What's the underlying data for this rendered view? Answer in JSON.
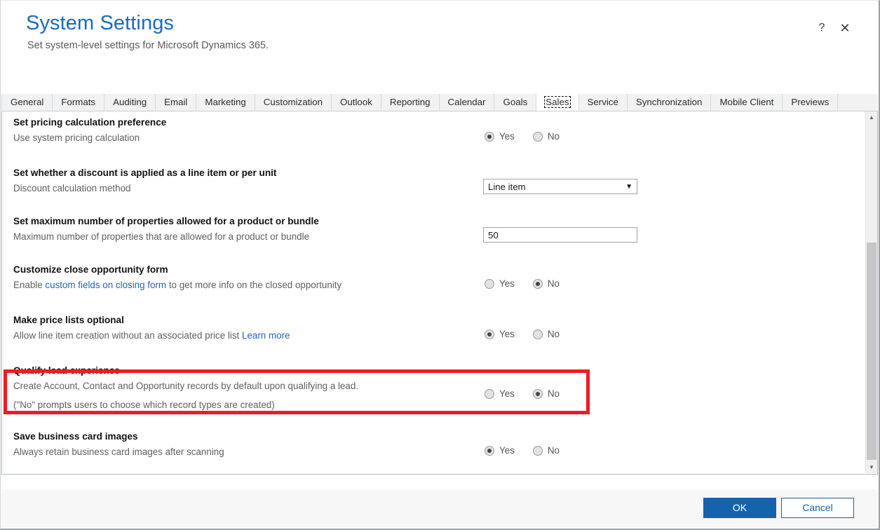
{
  "window": {
    "title": "System Settings",
    "subtitle": "Set system-level settings for Microsoft Dynamics 365.",
    "help_icon": "question-mark-icon",
    "close_icon": "close-icon",
    "accent_color": "#1a6bbd",
    "highlight_color": "#ed1c24"
  },
  "tabs": [
    {
      "label": "General",
      "active": false
    },
    {
      "label": "Formats",
      "active": false
    },
    {
      "label": "Auditing",
      "active": false
    },
    {
      "label": "Email",
      "active": false
    },
    {
      "label": "Marketing",
      "active": false
    },
    {
      "label": "Customization",
      "active": false
    },
    {
      "label": "Outlook",
      "active": false
    },
    {
      "label": "Reporting",
      "active": false
    },
    {
      "label": "Calendar",
      "active": false
    },
    {
      "label": "Goals",
      "active": false
    },
    {
      "label": "Sales",
      "active": true
    },
    {
      "label": "Service",
      "active": false
    },
    {
      "label": "Synchronization",
      "active": false
    },
    {
      "label": "Mobile Client",
      "active": false
    },
    {
      "label": "Previews",
      "active": false
    }
  ],
  "settings": [
    {
      "title": "Set pricing calculation preference",
      "desc": "Use system pricing calculation",
      "control": "radio",
      "yes_label": "Yes",
      "no_label": "No",
      "selected": "Yes"
    },
    {
      "title": "Set whether a discount is applied as a line item or per unit",
      "desc": "Discount calculation method",
      "control": "select",
      "value": "Line item",
      "arrow": "▼"
    },
    {
      "title": "Set maximum number of properties allowed for a product or bundle",
      "desc": "Maximum number of properties that are allowed for a product or bundle",
      "control": "text",
      "value": "50"
    },
    {
      "title": "Customize close opportunity form",
      "desc_pre": "Enable ",
      "desc_link": "custom fields on closing form",
      "desc_post": " to get more info on the closed opportunity",
      "control": "radio",
      "yes_label": "Yes",
      "no_label": "No",
      "selected": "No",
      "highlighted": true
    },
    {
      "title": "Make price lists optional",
      "desc_pre": "Allow line item creation without an associated price list ",
      "desc_link": "Learn more",
      "desc_post": "",
      "control": "radio",
      "yes_label": "Yes",
      "no_label": "No",
      "selected": "Yes"
    },
    {
      "title": "Qualify lead experience",
      "desc": "Create Account, Contact and Opportunity records by default upon qualifying a lead.",
      "desc2": "(\"No\" prompts users to choose which record types are created)",
      "control": "radio",
      "yes_label": "Yes",
      "no_label": "No",
      "selected": "No"
    },
    {
      "title": "Save business card images",
      "desc": "Always retain business card images after scanning",
      "control": "radio",
      "yes_label": "Yes",
      "no_label": "No",
      "selected": "Yes"
    }
  ],
  "scrollbar": {
    "up_arrow": "▲",
    "down_arrow": "▼"
  },
  "footer": {
    "ok_label": "OK",
    "cancel_label": "Cancel"
  }
}
